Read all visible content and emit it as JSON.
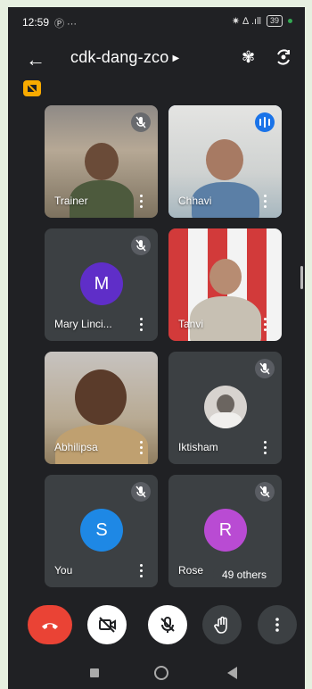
{
  "status": {
    "time": "12:59",
    "left_icons": "Ⓟ ···",
    "signal": "✷ ∆ .ıll",
    "battery": "39"
  },
  "header": {
    "meeting_code": "cdk-dang-zco",
    "back_icon": "back-arrow-icon",
    "bluetooth_icon": "bluetooth-icon",
    "switch_camera_icon": "switch-camera-icon"
  },
  "participants": [
    {
      "name": "Trainer",
      "muted": true,
      "video": true
    },
    {
      "name": "Chhavi",
      "muted": false,
      "speaking": true,
      "video": true
    },
    {
      "name": "Mary Linci...",
      "muted": true,
      "video": false,
      "initial": "M",
      "color": "#5f2ec8"
    },
    {
      "name": "Tanvi",
      "muted": false,
      "video": true
    },
    {
      "name": "Abhilipsa",
      "muted": false,
      "video": true
    },
    {
      "name": "Iktisham",
      "muted": true,
      "video": false
    },
    {
      "name": "You",
      "muted": true,
      "video": false,
      "initial": "S",
      "color": "#1e88e5"
    },
    {
      "name": "Rose",
      "muted": true,
      "video": false,
      "initial": "R",
      "color": "#b94bd3"
    }
  ],
  "others_label": "49 others",
  "controls": [
    "end-call",
    "camera-off",
    "mic-off",
    "raise-hand",
    "more-options"
  ]
}
